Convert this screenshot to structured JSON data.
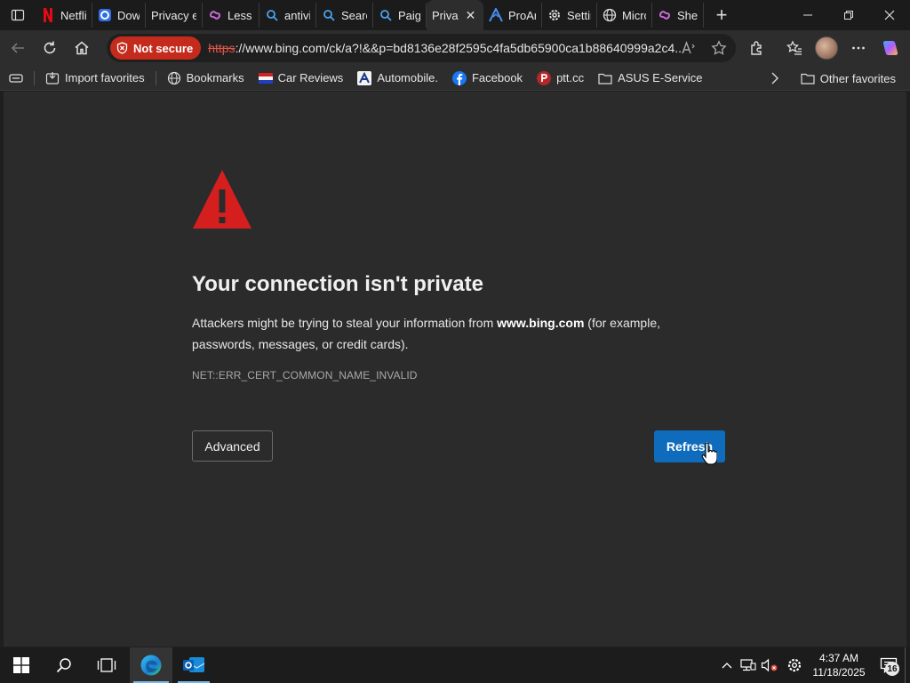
{
  "browser": {
    "tabs": [
      {
        "title": "Netflix",
        "icon": "netflix-icon",
        "width": 64
      },
      {
        "title": "Down",
        "icon": "download-app-icon",
        "width": 60
      },
      {
        "title": "Privacy err",
        "icon": "none",
        "width": 64
      },
      {
        "title": "Less s",
        "icon": "copilot-icon",
        "width": 64
      },
      {
        "title": "antivi",
        "icon": "search-icon",
        "width": 64
      },
      {
        "title": "Searc",
        "icon": "search-icon",
        "width": 64
      },
      {
        "title": "Paige",
        "icon": "search-icon",
        "width": 60
      },
      {
        "title": "Priva",
        "icon": "none",
        "width": 64,
        "active": true
      },
      {
        "title": "ProAr",
        "icon": "proart-icon",
        "width": 66
      },
      {
        "title": "Settir",
        "icon": "gear-icon",
        "width": 62
      },
      {
        "title": "Micrc",
        "icon": "globe-icon",
        "width": 62
      },
      {
        "title": "She's",
        "icon": "copilot-icon",
        "width": 58
      }
    ],
    "address": {
      "security_label": "Not secure",
      "url_scheme": "https",
      "url_rest": "://www.bing.com/ck/a?!&&p=bd8136e28f2595c4fa5db65900ca1b88640999a2c4..."
    },
    "favorites": [
      {
        "label": "Import favorites",
        "icon": "import-icon"
      },
      {
        "label": "Bookmarks",
        "icon": "globe-icon"
      },
      {
        "label": "Car Reviews",
        "icon": "flag-icon"
      },
      {
        "label": "Automobile.",
        "icon": "automobile-logo-icon"
      },
      {
        "label": "Facebook",
        "icon": "facebook-icon"
      },
      {
        "label": "ptt.cc",
        "icon": "ptt-icon"
      },
      {
        "label": "ASUS E-Service",
        "icon": "folder-icon"
      }
    ],
    "other_favorites": "Other favorites"
  },
  "page": {
    "title": "Your connection isn't private",
    "desc_before": "Attackers might be trying to steal your information from ",
    "desc_host": "www.bing.com",
    "desc_after": " (for example, passwords, messages, or credit cards).",
    "error_code": "NET::ERR_CERT_COMMON_NAME_INVALID",
    "advanced_label": "Advanced",
    "refresh_label": "Refresh"
  },
  "taskbar": {
    "time": "4:37 AM",
    "date": "11/18/2025",
    "notification_count": "16"
  },
  "colors": {
    "accent": "#0f6cbd",
    "warning": "#d51f1f",
    "not_secure": "#c42b1c"
  }
}
